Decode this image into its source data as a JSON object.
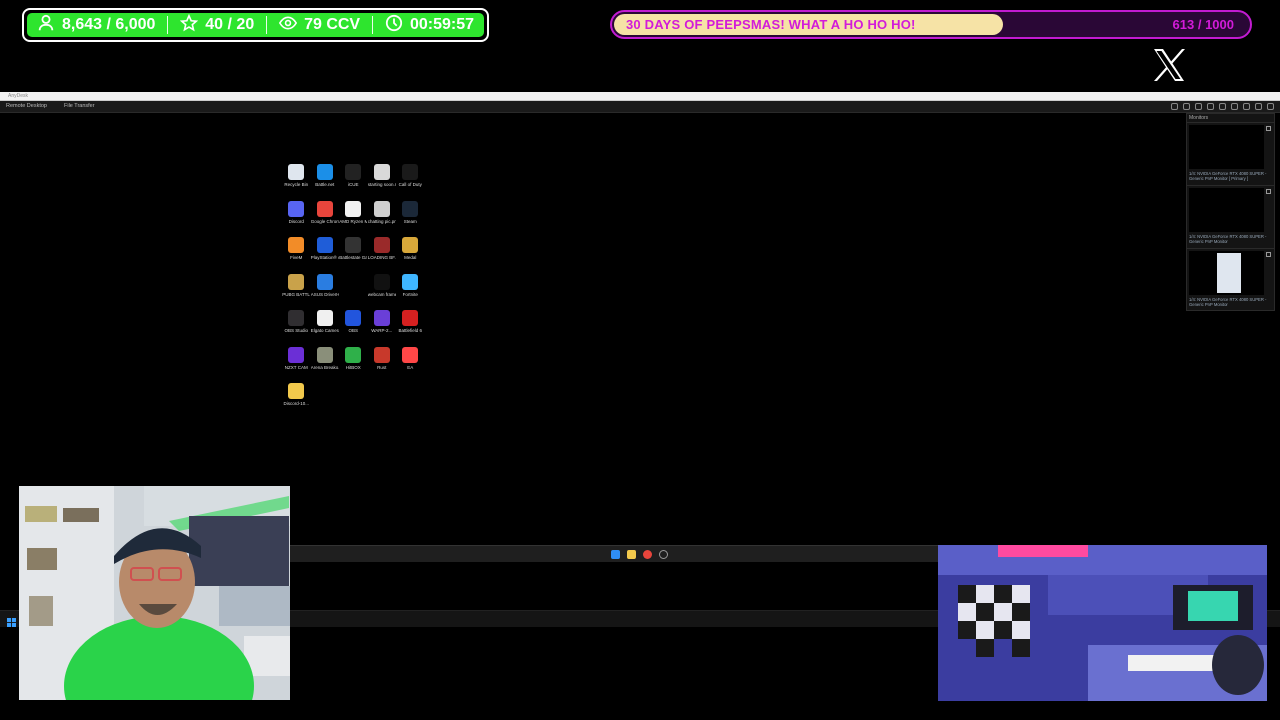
{
  "stats": {
    "followers": "8,643 / 6,000",
    "subs": "40 / 20",
    "viewers": "79 CCV",
    "timer": "00:59:57"
  },
  "goal": {
    "title": "30 DAYS OF PEEPSMAS! WHAT A HO HO HO!",
    "current": 613,
    "target": 1000,
    "count_text": "613 / 1000",
    "progress": 0.613
  },
  "remote_desktop": {
    "window_title": "AnyDesk",
    "tabs": [
      "Remote Desktop",
      "File Transfer"
    ]
  },
  "desktop_icons": [
    {
      "label": "Recycle Bin",
      "icon": "recycle-bin-icon",
      "color": "#dfe6ee"
    },
    {
      "label": "Battle.net",
      "icon": "battlenet-icon",
      "color": "#1b8fe8"
    },
    {
      "label": "iCUE",
      "icon": "icue-icon",
      "color": "#222222"
    },
    {
      "label": "starting soon.mp4",
      "icon": "video-file-icon",
      "color": "#d9d9d9"
    },
    {
      "label": "Call of Duty",
      "icon": "call-of-duty-icon",
      "color": "#1a1a1a"
    },
    {
      "label": "Discord",
      "icon": "discord-icon",
      "color": "#5865f2"
    },
    {
      "label": "Google Chrome",
      "icon": "chrome-icon",
      "color": "#e8453c"
    },
    {
      "label": "AMD Ryzen Master",
      "icon": "ryzen-master-icon",
      "color": "#f2f2f2"
    },
    {
      "label": "chatting pic.png",
      "icon": "image-file-icon",
      "color": "#cfcfcf"
    },
    {
      "label": "Steam",
      "icon": "steam-icon",
      "color": "#1b2838"
    },
    {
      "label": "FiveM",
      "icon": "fivem-icon",
      "color": "#f28c28"
    },
    {
      "label": "PlayStation® Accessories",
      "icon": "playstation-icon",
      "color": "#1f5dd8"
    },
    {
      "label": "Battlestate Games L...",
      "icon": "battlestate-icon",
      "color": "#333333"
    },
    {
      "label": "LOADING BF.mp4",
      "icon": "video-file-icon",
      "color": "#9a2a2a"
    },
    {
      "label": "Medal",
      "icon": "medal-icon",
      "color": "#d8a83a"
    },
    {
      "label": "PUBG BATTLEGR...",
      "icon": "pubg-icon",
      "color": "#c9a24a"
    },
    {
      "label": "ASUS DriverHub",
      "icon": "asus-icon",
      "color": "#2a7de1"
    },
    {
      "label": "",
      "icon": "blank-icon",
      "color": "#000000"
    },
    {
      "label": "webcam frame.png",
      "icon": "image-file-icon",
      "color": "#111111"
    },
    {
      "label": "Fortnite",
      "icon": "fortnite-icon",
      "color": "#3fb6ff"
    },
    {
      "label": "OBS Studio",
      "icon": "obs-icon",
      "color": "#302e31"
    },
    {
      "label": "Elgato Camera Hub - Copy",
      "icon": "elgato-icon",
      "color": "#f0f0f0"
    },
    {
      "label": "OBS",
      "icon": "obs-icon-2",
      "color": "#2255dd"
    },
    {
      "label": "WARP-2...",
      "icon": "warp-icon",
      "color": "#6a3fd8"
    },
    {
      "label": "Battlefield 6",
      "icon": "battlefield-icon",
      "color": "#d62020"
    },
    {
      "label": "NZXT CAM",
      "icon": "nzxt-icon",
      "color": "#6b2fd6"
    },
    {
      "label": "Arena Breako...",
      "icon": "arena-breakout-icon",
      "color": "#8a8f7a"
    },
    {
      "label": "HitBOX",
      "icon": "hitbox-icon",
      "color": "#2fb04a"
    },
    {
      "label": "Rust",
      "icon": "rust-icon",
      "color": "#c8392b"
    },
    {
      "label": "EA",
      "icon": "ea-icon",
      "color": "#ff4747"
    },
    {
      "label": "Discord-10...",
      "icon": "folder-icon",
      "color": "#f2c94c"
    }
  ],
  "monitors": {
    "header": "Monitors",
    "items": [
      {
        "label": "1/4: NVIDIA GeForce RTX 4080 SUPER - Generic PnP Monitor [ Primary ]"
      },
      {
        "label": "1/4: NVIDIA GeForce RTX 4080 SUPER - Generic PnP Monitor"
      },
      {
        "label": "1/4: NVIDIA GeForce RTX 4080 SUPER - Generic PnP Monitor"
      }
    ]
  },
  "colors": {
    "stats_green": "#2ee52e",
    "goal_fill": "#f6e3a6",
    "goal_text": "#d21bd9",
    "goal_border": "#c21bd1"
  }
}
